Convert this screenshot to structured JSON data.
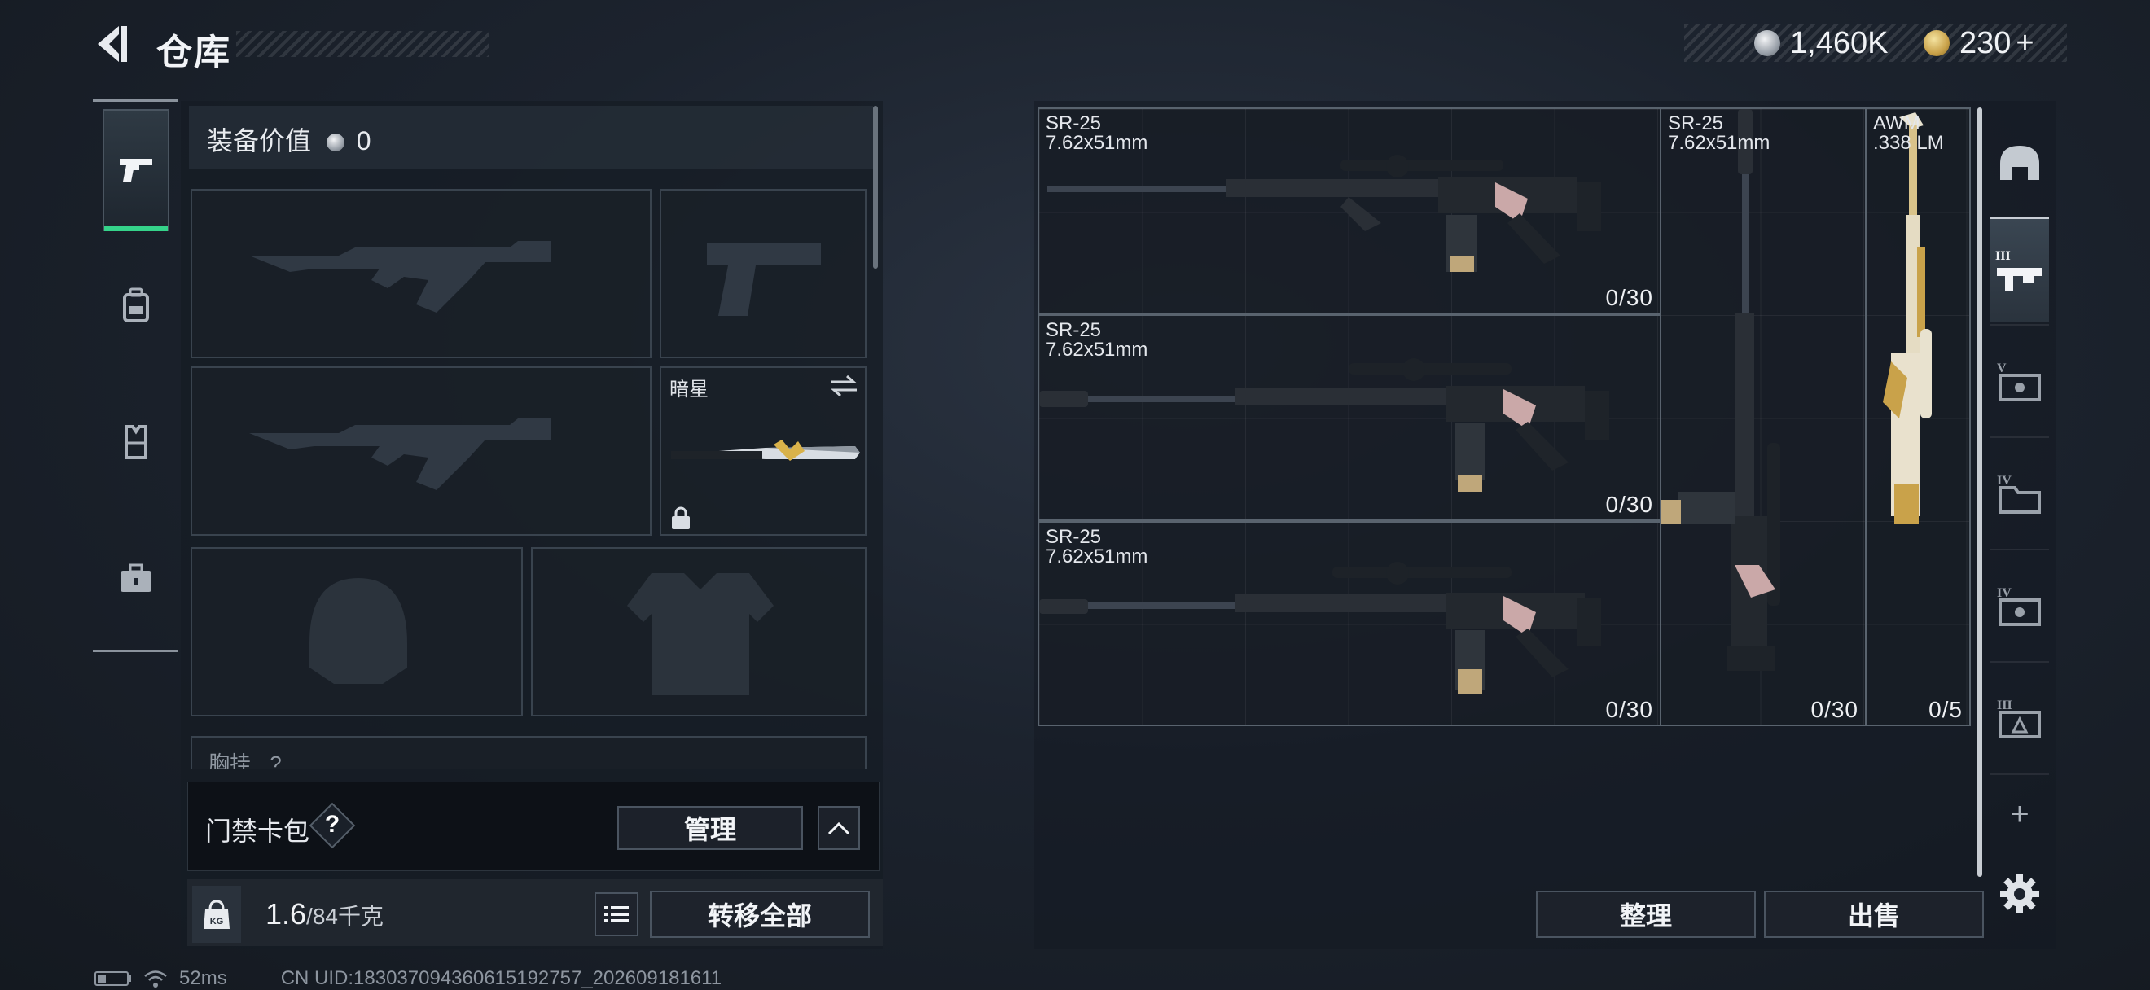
{
  "header": {
    "title": "仓库",
    "currencies": [
      {
        "icon": "silver-coin-icon",
        "value": "1,460K"
      },
      {
        "icon": "gold-coin-icon",
        "value": "230",
        "add": "+"
      }
    ]
  },
  "left_rail": {
    "tabs": [
      {
        "name": "weapons",
        "icon": "pistol-icon",
        "active": true
      },
      {
        "name": "backpack",
        "icon": "backpack-icon",
        "active": false
      },
      {
        "name": "vest",
        "icon": "vest-icon",
        "active": false
      },
      {
        "name": "toolbox",
        "icon": "toolbox-icon",
        "active": false
      }
    ]
  },
  "loadout": {
    "value_label": "装备价值",
    "value": "0",
    "slots": [
      {
        "name": "primary-weapon-slot",
        "kind": "rifle",
        "empty": true
      },
      {
        "name": "pistol-slot",
        "kind": "pistol",
        "empty": true
      },
      {
        "name": "secondary-weapon-slot",
        "kind": "rifle",
        "empty": true
      },
      {
        "name": "melee-slot",
        "label": "暗星",
        "kind": "knife",
        "empty": false
      },
      {
        "name": "helmet-slot",
        "kind": "helmet",
        "empty": true
      },
      {
        "name": "armor-slot",
        "kind": "armor",
        "empty": true
      }
    ],
    "chest_rig_label": "胸挂",
    "chest_rig_count": "?",
    "keycard_label": "门禁卡包",
    "keycard_help": "?",
    "manage_button": "管理",
    "weight_value": "1.6",
    "weight_max": "/84千克",
    "weight_icon_text": "KG",
    "transfer_all_button": "转移全部"
  },
  "storage": {
    "items": [
      {
        "name": "SR-25",
        "caliber": "7.62x51mm",
        "ammo": "0/30"
      },
      {
        "name": "SR-25",
        "caliber": "7.62x51mm",
        "ammo": "0/30"
      },
      {
        "name": "SR-25",
        "caliber": "7.62x51mm",
        "ammo": "0/30"
      },
      {
        "name": "SR-25",
        "caliber": "7.62x51mm",
        "ammo": "0/30"
      },
      {
        "name": "AWM",
        "caliber": ".338 LM",
        "ammo": "0/5"
      }
    ],
    "sort_button": "整理",
    "sell_button": "出售"
  },
  "right_rail": {
    "tabs": [
      {
        "name": "helmet-storage",
        "icon": "helmet-icon"
      },
      {
        "name": "tier-3-weapons",
        "icon": "tier-iii-rifle-icon",
        "active": true
      },
      {
        "name": "tier-5-storage",
        "icon": "tier-v-box-icon"
      },
      {
        "name": "tier-4-storage",
        "icon": "tier-iv-folder-icon"
      },
      {
        "name": "tier-4-box",
        "icon": "tier-iv-box-icon"
      },
      {
        "name": "tier-3-box",
        "icon": "tier-iii-box-icon"
      }
    ],
    "add_label": "+"
  },
  "footer": {
    "ping": "52ms",
    "uid": "CN UID:183037094360615192757_202609181611"
  },
  "colors": {
    "accent_green": "#35d38a",
    "panel_bg": "#161c24",
    "border": "#59636e"
  }
}
